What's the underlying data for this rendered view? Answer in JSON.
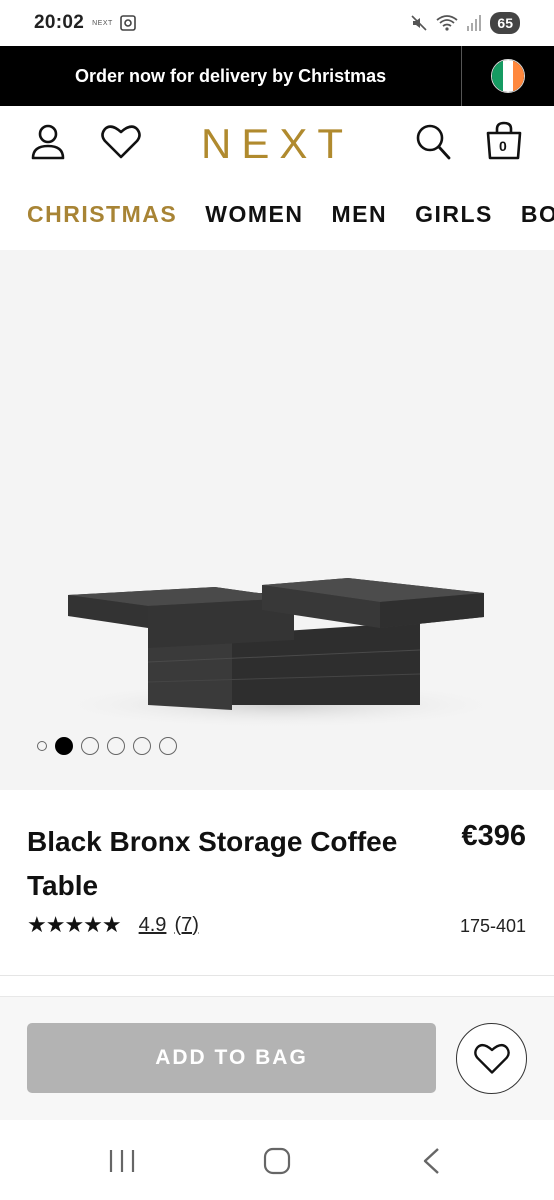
{
  "status_bar": {
    "time": "20:02",
    "app_label": "NEXT",
    "battery": "65"
  },
  "promo": {
    "text": "Order now for delivery by Christmas",
    "flag_colors": [
      "#169b62",
      "#ffffff",
      "#ff883e"
    ]
  },
  "header": {
    "logo": "NEXT",
    "bag_count": "0",
    "logo_color": "#b08a2e"
  },
  "nav": {
    "items": [
      "CHRISTMAS",
      "WOMEN",
      "MEN",
      "GIRLS",
      "BOYS"
    ],
    "active_index": 0,
    "active_color": "#a88435"
  },
  "gallery": {
    "image_count": 6,
    "active_index": 1
  },
  "product": {
    "title": "Black Bronx Storage Coffee Table",
    "price": "€396",
    "rating_stars": "★★★★★",
    "rating_value": "4.9",
    "rating_count": "(7)",
    "item_code": "175-401"
  },
  "cta": {
    "add_to_bag": "ADD TO BAG"
  }
}
